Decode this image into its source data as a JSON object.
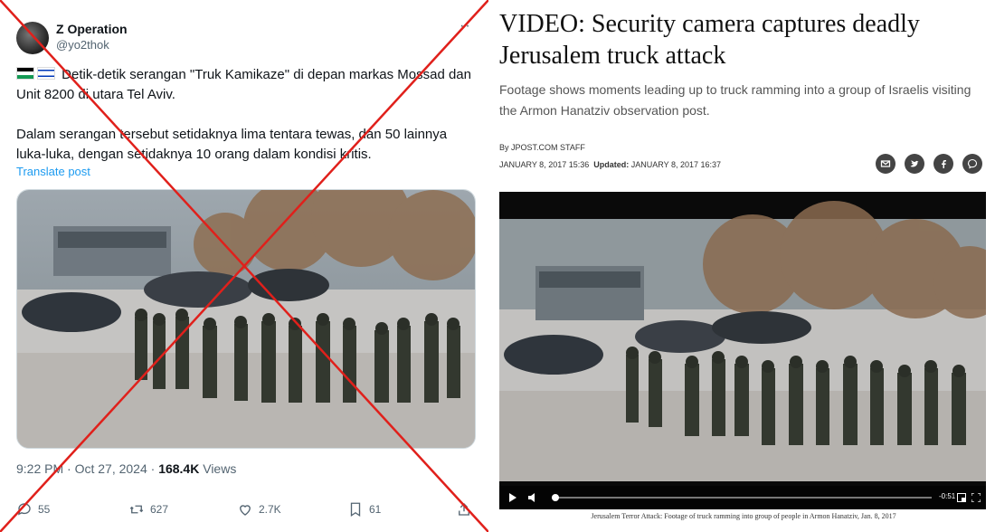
{
  "tweet": {
    "display_name": "Z Operation",
    "handle": "@yo2thok",
    "more": "··",
    "text_line1": "Detik-detik serangan \"Truk Kamikaze\" di depan markas Mossad dan Unit 8200 di utara Tel Aviv.",
    "text_line2": "Dalam serangan tersebut setidaknya lima tentara tewas, dan 50 lainnya luka-luka, dengan setidaknya 10 orang dalam kondisi kritis.",
    "translate_label": "Translate post",
    "timestamp": "9:22 PM · Oct 27, 2024 · ",
    "views_count": "168.4K",
    "views_label": " Views",
    "actions": {
      "replies": "55",
      "reposts": "627",
      "likes": "2.7K",
      "bookmarks": "61"
    },
    "icons": [
      "reply-icon",
      "repost-icon",
      "like-icon",
      "bookmark-icon",
      "share-icon"
    ],
    "accent_color": "#1d9bf0",
    "overlay_color": "#e0201b"
  },
  "article": {
    "headline": "VIDEO: Security camera captures deadly Jerusalem truck attack",
    "subhead": "Footage shows moments leading up to truck ramming into a group of Israelis visiting the Armon Hanatziv observation post.",
    "byline": "By JPOST.COM STAFF",
    "published": "JANUARY 8, 2017 15:36",
    "updated_label": "Updated:",
    "updated": "JANUARY 8, 2017 16:37",
    "share_icons": [
      "email-icon",
      "twitter-icon",
      "facebook-icon",
      "messenger-icon"
    ],
    "video": {
      "time": "-0:51"
    },
    "caption": "Jerusalem Terror Attack: Footage of truck ramming into group of people in Armon Hanatziv, Jan. 8, 2017"
  }
}
